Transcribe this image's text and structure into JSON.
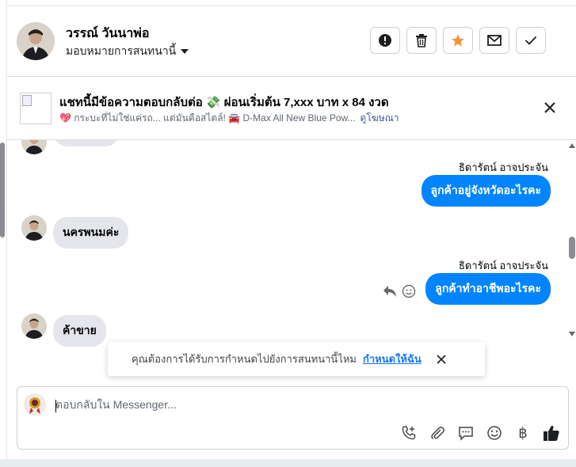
{
  "header": {
    "name": "วรรณ์ วันนาพ่อ",
    "assign_label": "มอบหมายการสนทนานี้"
  },
  "ad": {
    "title": "แชทนี้มีข้อความตอบกลับต่อ 💸 ผ่อนเริ่มต้น 7,xxx บาท x 84 งวด",
    "subtitle": "💖 กระบะที่ไม่ใช่แค่รถ... แต่มันคือสไตล์! 🚘 D-Max All New Blue Pow...",
    "link": "ดูโฆษณา"
  },
  "messages": [
    {
      "sender": "ธิดารัตน์ อาจประจัน",
      "text": "ลูกค้าอยู่จังหวัดอะไรคะ"
    },
    {
      "text": "นครพนมค่ะ"
    },
    {
      "sender": "ธิดารัตน์ อาจประจัน",
      "text": "ลูกค้าทำอาชีพอะไรคะ"
    },
    {
      "text": "ค้าขาย"
    }
  ],
  "toast": {
    "text": "คุณต้องการได้รับการกำหนดไปยังการสนทนานี้ไหม",
    "link": "กำหนดให้ฉัน"
  },
  "composer": {
    "placeholder": "ตอบกลับใน Messenger..."
  },
  "icons": {
    "baht": "฿"
  },
  "colors": {
    "brand_blue": "#0084ff",
    "star_orange": "#f7923a",
    "link_blue": "#1877f2"
  }
}
